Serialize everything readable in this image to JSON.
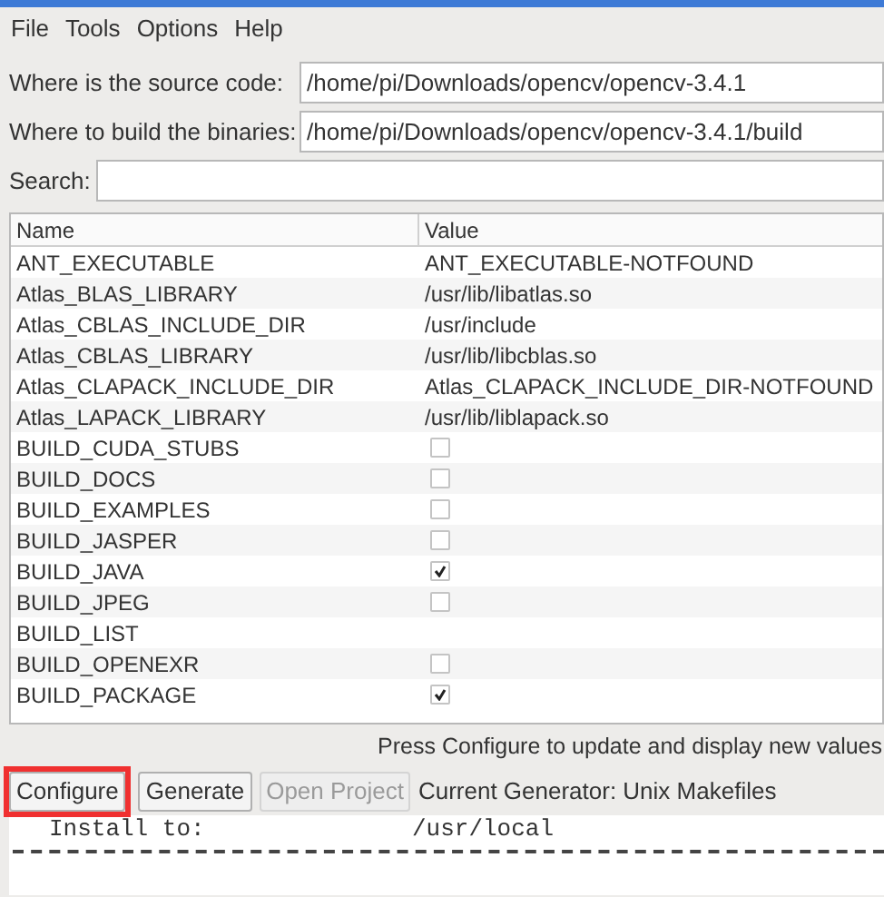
{
  "menu": [
    "File",
    "Tools",
    "Options",
    "Help"
  ],
  "source": {
    "label": "Where is the source code:",
    "value": "/home/pi/Downloads/opencv/opencv-3.4.1"
  },
  "build": {
    "label": "Where to build the binaries:",
    "value": "/home/pi/Downloads/opencv/opencv-3.4.1/build"
  },
  "search": {
    "label": "Search:"
  },
  "table": {
    "columns": [
      "Name",
      "Value"
    ],
    "rows": [
      {
        "name": "ANT_EXECUTABLE",
        "kind": "text",
        "value": "ANT_EXECUTABLE-NOTFOUND"
      },
      {
        "name": "Atlas_BLAS_LIBRARY",
        "kind": "text",
        "value": "/usr/lib/libatlas.so"
      },
      {
        "name": "Atlas_CBLAS_INCLUDE_DIR",
        "kind": "text",
        "value": "/usr/include"
      },
      {
        "name": "Atlas_CBLAS_LIBRARY",
        "kind": "text",
        "value": "/usr/lib/libcblas.so"
      },
      {
        "name": "Atlas_CLAPACK_INCLUDE_DIR",
        "kind": "text",
        "value": "Atlas_CLAPACK_INCLUDE_DIR-NOTFOUND"
      },
      {
        "name": "Atlas_LAPACK_LIBRARY",
        "kind": "text",
        "value": "/usr/lib/liblapack.so"
      },
      {
        "name": "BUILD_CUDA_STUBS",
        "kind": "bool",
        "checked": false
      },
      {
        "name": "BUILD_DOCS",
        "kind": "bool",
        "checked": false
      },
      {
        "name": "BUILD_EXAMPLES",
        "kind": "bool",
        "checked": false
      },
      {
        "name": "BUILD_JASPER",
        "kind": "bool",
        "checked": false
      },
      {
        "name": "BUILD_JAVA",
        "kind": "bool",
        "checked": true
      },
      {
        "name": "BUILD_JPEG",
        "kind": "bool",
        "checked": false
      },
      {
        "name": "BUILD_LIST",
        "kind": "empty"
      },
      {
        "name": "BUILD_OPENEXR",
        "kind": "bool",
        "checked": false
      },
      {
        "name": "BUILD_PACKAGE",
        "kind": "bool",
        "checked": true
      }
    ]
  },
  "hint": "Press Configure to update and display new values",
  "buttons": [
    {
      "label": "Configure",
      "disabled": false,
      "highlighted": true
    },
    {
      "label": "Generate",
      "disabled": false,
      "highlighted": false
    },
    {
      "label": "Open Project",
      "disabled": true,
      "highlighted": false
    }
  ],
  "generator": "Current Generator: Unix Makefiles",
  "log": [
    {
      "label": "Install to:",
      "value": "/usr/local"
    }
  ]
}
